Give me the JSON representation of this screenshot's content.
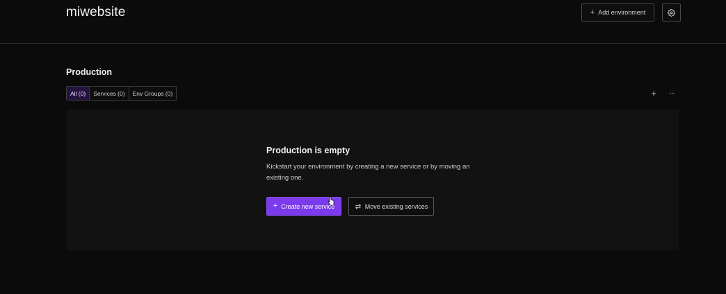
{
  "header": {
    "project_title": "miwebsite",
    "add_environment_label": "Add environment",
    "add_icon": "plus-icon",
    "settings_icon": "gear-icon"
  },
  "environment": {
    "title": "Production",
    "tabs": [
      {
        "label": "All (0)",
        "active": true
      },
      {
        "label": "Services (0)",
        "active": false
      },
      {
        "label": "Env Groups (0)",
        "active": false
      }
    ],
    "actions": {
      "add_icon": "plus-icon",
      "more_icon": "more-horizontal-icon"
    }
  },
  "empty_state": {
    "title": "Production is empty",
    "description": "Kickstart your environment by creating a new service or by moving an existing one.",
    "create_label": "Create new service",
    "move_label": "Move existing services",
    "create_icon": "plus-icon",
    "move_icon": "swap-arrows-icon"
  },
  "colors": {
    "background": "#0b0b0b",
    "panel": "#121212",
    "accent": "#7c3aed",
    "active_tab": "#24123f"
  }
}
